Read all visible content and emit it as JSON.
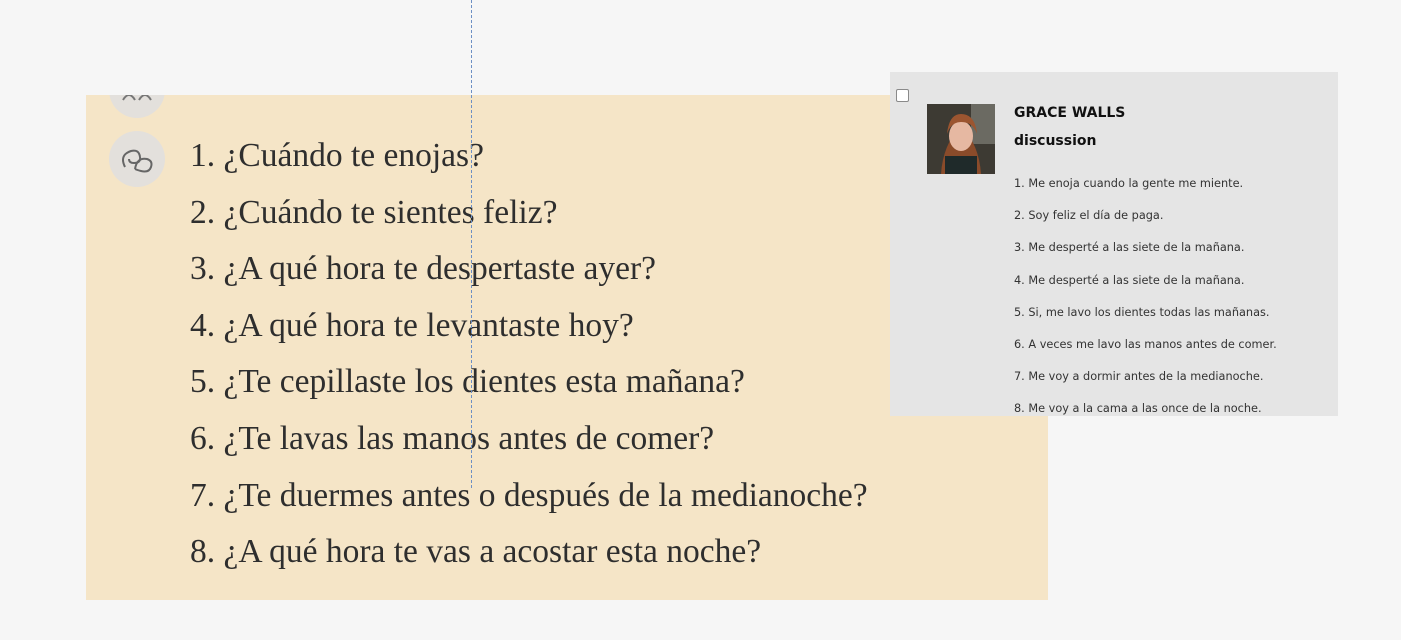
{
  "textbook": {
    "questions": [
      "1. ¿Cuándo te enojas?",
      "2. ¿Cuándo te sientes feliz?",
      "3. ¿A qué hora te despertaste ayer?",
      "4. ¿A qué hora te levantaste hoy?",
      "5. ¿Te cepillaste los dientes esta mañana?",
      "6. ¿Te lavas las manos antes de comer?",
      "7. ¿Te duermes antes o después de la medianoche?",
      "8. ¿A qué hora te vas a acostar esta noche?"
    ],
    "icons": [
      "pair-activity-icon",
      "discussion-icon"
    ],
    "background_color": "#f5e5c7"
  },
  "comment": {
    "author": "GRACE WALLS",
    "subtitle": "discussion",
    "answers": [
      "1. Me enoja cuando la gente me miente.",
      "2. Soy feliz el día de paga.",
      "3. Me desperté a las siete de la mañana.",
      "4. Me desperté a las siete de la mañana.",
      "5. Si, me lavo los dientes todas las mañanas.",
      "6. A veces me lavo las manos antes de comer.",
      "7. Me voy a dormir antes de la medianoche.",
      "8. Me voy a la cama a las once de la noche."
    ],
    "checked": false
  }
}
